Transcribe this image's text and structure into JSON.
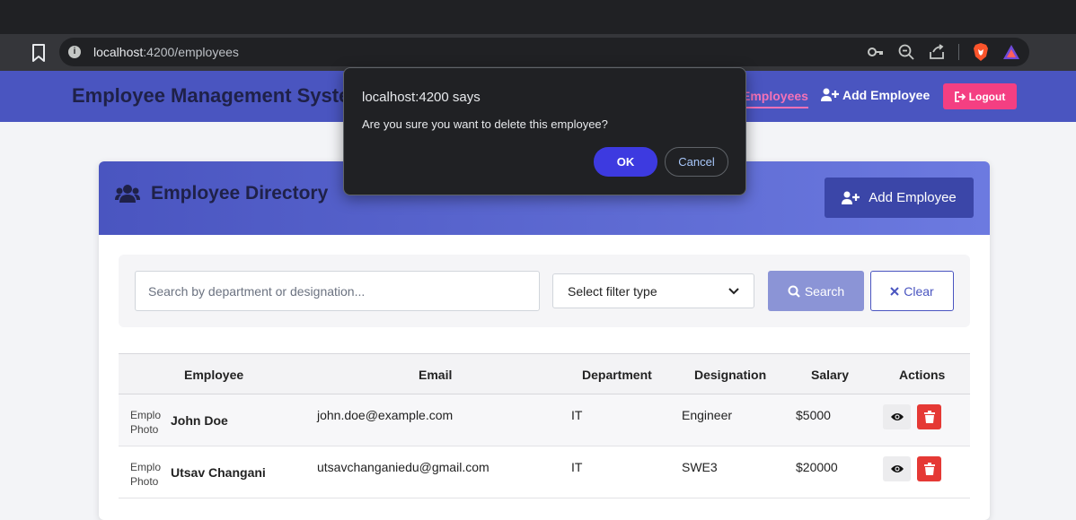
{
  "browser": {
    "url_host": "localhost",
    "url_rest": ":4200/employees"
  },
  "navbar": {
    "brand": "Employee Management System",
    "link_employees": "Employees",
    "link_add": "Add Employee",
    "logout": "Logout"
  },
  "card": {
    "title": "Employee Directory",
    "add_button": "Add Employee"
  },
  "filters": {
    "search_placeholder": "Search by department or designation...",
    "select_label": "Select filter type",
    "search_button": "Search",
    "clear_button": "Clear"
  },
  "table": {
    "headers": [
      "Employee",
      "Email",
      "Department",
      "Designation",
      "Salary",
      "Actions"
    ],
    "rows": [
      {
        "photo_alt": "Employee Photo",
        "name": "John Doe",
        "email": "john.doe@example.com",
        "department": "IT",
        "designation": "Engineer",
        "salary": "$5000"
      },
      {
        "photo_alt": "Employee Photo",
        "name": "Utsav Changani",
        "email": "utsavchanganiedu@gmail.com",
        "department": "IT",
        "designation": "SWE3",
        "salary": "$20000"
      }
    ]
  },
  "dialog": {
    "title": "localhost:4200 says",
    "message": "Are you sure you want to delete this employee?",
    "ok": "OK",
    "cancel": "Cancel"
  },
  "colors": {
    "navbar": "#4a55c0",
    "accent_pink": "#f43f82",
    "delete_red": "#e53935",
    "dialog_ok": "#3d3ae0"
  }
}
